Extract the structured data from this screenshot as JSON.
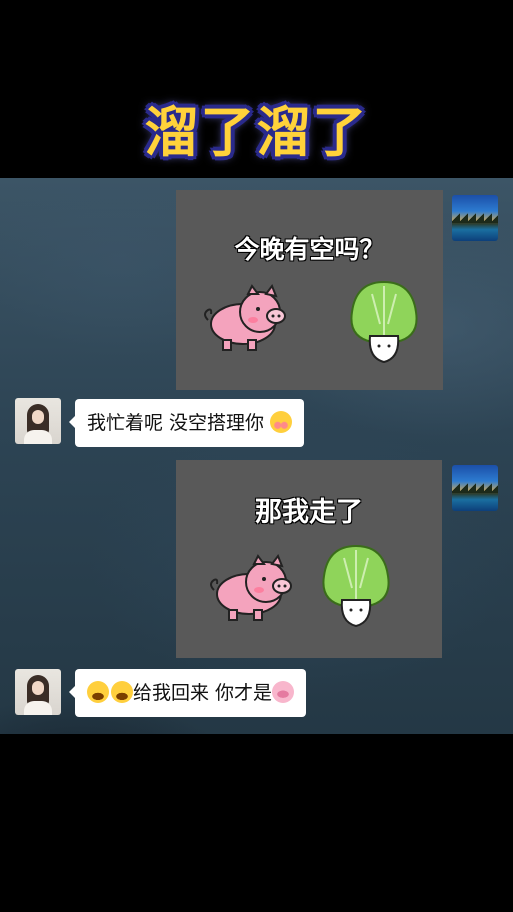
{
  "title": "溜了溜了",
  "messages": [
    {
      "side": "right",
      "type": "image",
      "caption": "今晚有空吗？"
    },
    {
      "side": "left",
      "type": "text",
      "text": "我忙着呢 没空搭理你",
      "trailing_emoji": "shy-face-emoji"
    },
    {
      "side": "right",
      "type": "image",
      "caption": "那我走了"
    },
    {
      "side": "left",
      "type": "text",
      "leading_emojis": [
        "crying-laughing-emoji",
        "crying-laughing-emoji"
      ],
      "text": "给我回来 你才是",
      "trailing_emoji": "pig-face-emoji"
    }
  ],
  "colors": {
    "title_fill": "#ffd23a",
    "title_outline": "#2a2a8c",
    "card_bg": "#595959",
    "bubble_bg": "#ffffff",
    "pig": "#f4a3bd",
    "cabbage": "#8fd45a"
  }
}
